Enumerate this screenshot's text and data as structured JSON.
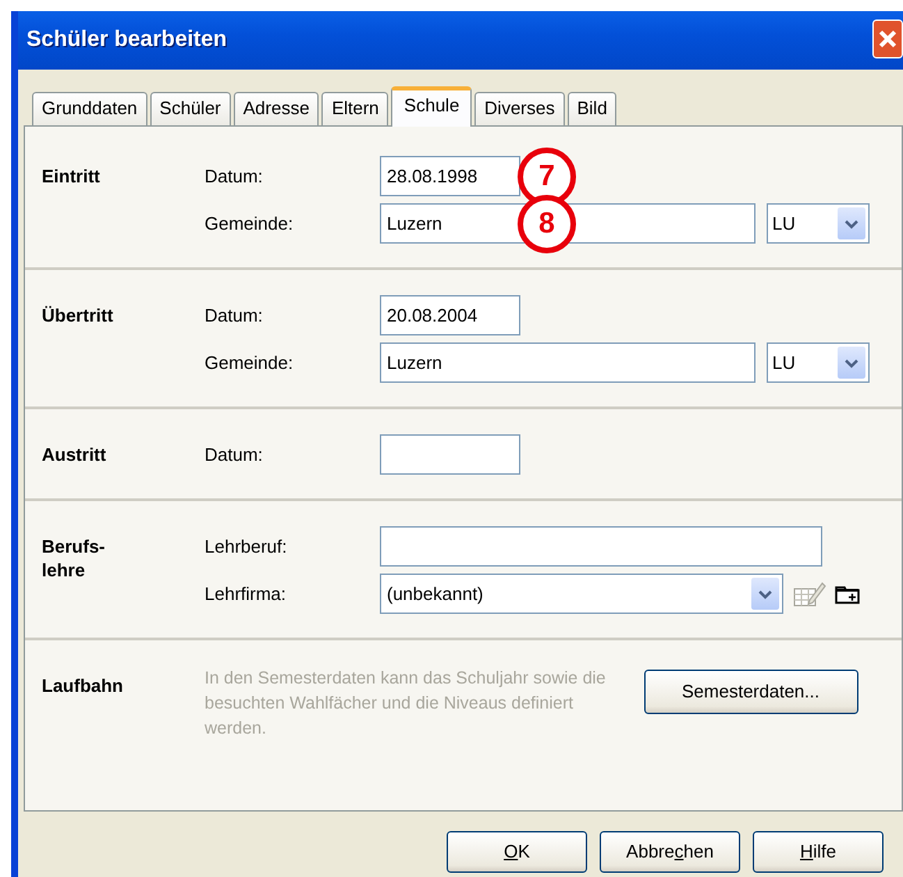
{
  "window": {
    "title": "Schüler bearbeiten"
  },
  "tabs": [
    {
      "label": "Grunddaten",
      "selected": false
    },
    {
      "label": "Schüler",
      "selected": false
    },
    {
      "label": "Adresse",
      "selected": false
    },
    {
      "label": "Eltern",
      "selected": false
    },
    {
      "label": "Schule",
      "selected": true
    },
    {
      "label": "Diverses",
      "selected": false
    },
    {
      "label": "Bild",
      "selected": false
    }
  ],
  "sections": [
    {
      "title": "Eintritt",
      "rows": [
        {
          "kind": "date",
          "label": "Datum:",
          "value": "28.08.1998",
          "callout": "7"
        },
        {
          "kind": "place",
          "label": "Gemeinde:",
          "value": "Luzern",
          "canton": "LU",
          "callout": "8"
        }
      ]
    },
    {
      "title": "Übertritt",
      "rows": [
        {
          "kind": "date",
          "label": "Datum:",
          "value": "20.08.2004"
        },
        {
          "kind": "place",
          "label": "Gemeinde:",
          "value": "Luzern",
          "canton": "LU"
        }
      ]
    },
    {
      "title": "Austritt",
      "rows": [
        {
          "kind": "date",
          "label": "Datum:"
        }
      ]
    },
    {
      "title": "Berufs-\nlehre",
      "rows": [
        {
          "kind": "text",
          "label": "Lehrberuf:"
        },
        {
          "kind": "company",
          "label": "Lehrfirma:",
          "value": "(unbekannt)"
        }
      ]
    },
    {
      "title": "Laufbahn",
      "note": "In den Semesterdaten kann das Schuljahr sowie die besuchten Wahlfächer und die Niveaus definiert werden.",
      "button": "Semesterdaten..."
    }
  ],
  "buttons": [
    {
      "key": "O",
      "after": "K"
    },
    {
      "before": "Abbre",
      "key": "c",
      "after": "hen"
    },
    {
      "key": "H",
      "after": "ilfe"
    }
  ]
}
